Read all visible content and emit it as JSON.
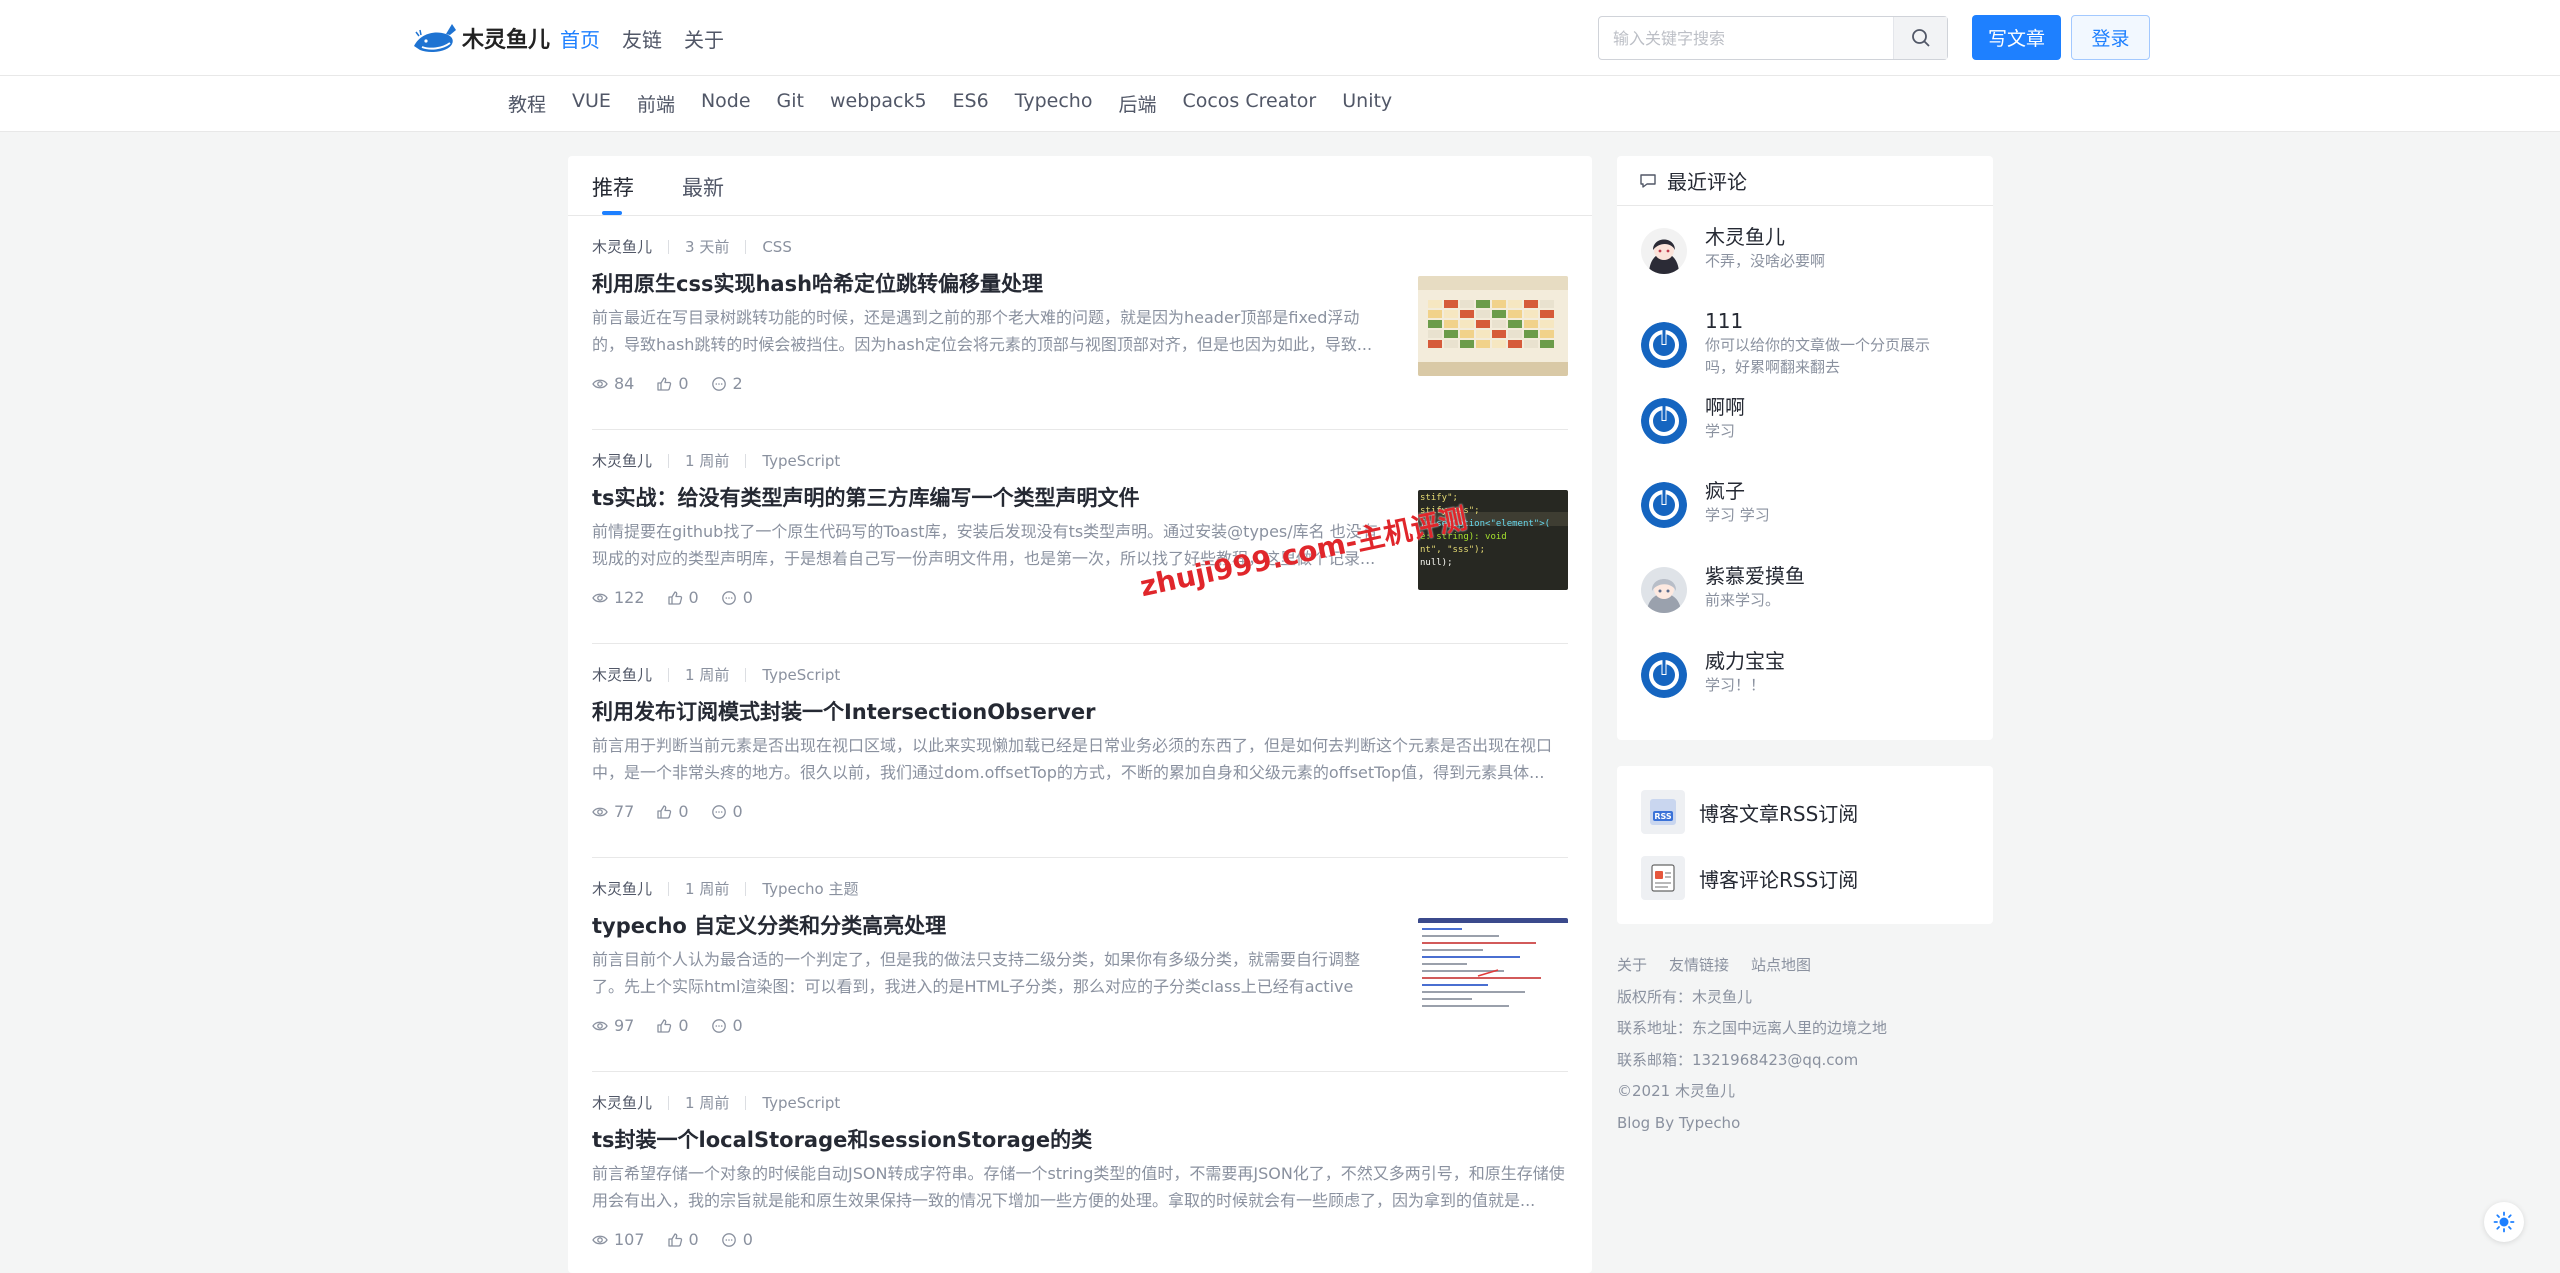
{
  "header": {
    "logo_text": "木灵鱼儿",
    "nav": [
      {
        "label": "首页",
        "active": true
      },
      {
        "label": "友链",
        "active": false
      },
      {
        "label": "关于",
        "active": false
      }
    ],
    "search": {
      "placeholder": "输入关键字搜索",
      "value": "",
      "icon": "search-icon"
    },
    "write_label": "写文章",
    "login_label": "登录"
  },
  "categories": [
    "教程",
    "VUE",
    "前端",
    "Node",
    "Git",
    "webpack5",
    "ES6",
    "Typecho",
    "后端",
    "Cocos Creator",
    "Unity"
  ],
  "tabs": [
    {
      "label": "推荐",
      "active": true
    },
    {
      "label": "最新",
      "active": false
    }
  ],
  "articles": [
    {
      "author": "木灵鱼儿",
      "time": "3 天前",
      "category": "CSS",
      "title": "利用原生css实现hash哈希定位跳转偏移量处理",
      "excerpt": "前言最近在写目录树跳转功能的时候，还是遇到之前的那个老大难的问题，就是因为header顶部是fixed浮动的，导致hash跳转的时候会被挡住。因为hash定位会将元素的顶部与视图顶部对齐，但是也因为如此，导致...",
      "views": "84",
      "likes": "0",
      "comments": "2",
      "thumb": "table"
    },
    {
      "author": "木灵鱼儿",
      "time": "1 周前",
      "category": "TypeScript",
      "title": "ts实战：给没有类型声明的第三方库编写一个类型声明文件",
      "excerpt": "前情提要在github找了一个原生代码写的Toast库，安装后发现没有ts类型声明。通过安装@types/库名 也没有现成的对应的类型声明库，于是想着自己写一份声明文件用，也是第一次，所以找了好些教程，这里做个记录...",
      "views": "122",
      "likes": "0",
      "comments": "0",
      "thumb": "code"
    },
    {
      "author": "木灵鱼儿",
      "time": "1 周前",
      "category": "TypeScript",
      "title": "利用发布订阅模式封装一个IntersectionObserver",
      "excerpt": "前言用于判断当前元素是否出现在视口区域，以此来实现懒加载已经是日常业务必须的东西了，但是如何去判断这个元素是否出现在视口中，是一个非常头疼的地方。很久以前，我们通过dom.offsetTop的方式，不断的累加自身和父级元素的offsetTop值，得到元素具体...",
      "views": "77",
      "likes": "0",
      "comments": "0",
      "thumb": "none"
    },
    {
      "author": "木灵鱼儿",
      "time": "1 周前",
      "category": "Typecho 主题",
      "title": "typecho 自定义分类和分类高亮处理",
      "excerpt": "前言目前个人认为最合适的一个判定了，但是我的做法只支持二级分类，如果你有多级分类，就需要自行调整了。先上个实际html渲染图：可以看到，我进入的是HTML子分类，那么对应的子分类class上已经有active类...",
      "views": "97",
      "likes": "0",
      "comments": "0",
      "thumb": "doc"
    },
    {
      "author": "木灵鱼儿",
      "time": "1 周前",
      "category": "TypeScript",
      "title": "ts封装一个localStorage和sessionStorage的类",
      "excerpt": "前言希望存储一个对象的时候能自动JSON转成字符串。存储一个string类型的值时，不需要再JSON化了，不然又多两引号，和原生存储使用会有出入，我的宗旨就是能和原生效果保持一致的情况下增加一些方便的处理。拿取的时候就会有一些顾虑了，因为拿到的值就是...",
      "views": "107",
      "likes": "0",
      "comments": "0",
      "thumb": "none"
    }
  ],
  "code_snippet": [
    "stify\";",
    "stify.css\";",
    "fy.setOption<\"element\">(",
    "e: string): void",
    "nt\", \"sss\");",
    " null);"
  ],
  "watermark": "zhuji999.com-主机评测",
  "sidebar": {
    "comments_title": "最近评论",
    "comments": [
      {
        "name": "木灵鱼儿",
        "text": "不弄，没啥必要啊",
        "avatar": "anime-girl"
      },
      {
        "name": "111",
        "text": "你可以给你的文章做一个分页展示吗，好累啊翻来翻去",
        "avatar": "default"
      },
      {
        "name": "啊啊",
        "text": "学习",
        "avatar": "default"
      },
      {
        "name": "疯子",
        "text": "学习 学习",
        "avatar": "default"
      },
      {
        "name": "紫慕爱摸鱼",
        "text": "前来学习。",
        "avatar": "anime-girl-2"
      },
      {
        "name": "威力宝宝",
        "text": "学习！！",
        "avatar": "default"
      }
    ],
    "rss": [
      {
        "label": "博客文章RSS订阅",
        "icon": "rss-icon"
      },
      {
        "label": "博客评论RSS订阅",
        "icon": "rss-comment-icon"
      }
    ]
  },
  "footer": {
    "links": [
      "关于",
      "友情链接",
      "站点地图"
    ],
    "owner": "版权所有：木灵鱼儿",
    "address": "联系地址：东之国中远离人里的边境之地",
    "email": "联系邮箱：1321968423@qq.com",
    "copyright": "©2021 木灵鱼儿",
    "powered": "Blog By Typecho"
  },
  "colors": {
    "accent": "#1e80ff",
    "watermark": "#e0262b"
  }
}
